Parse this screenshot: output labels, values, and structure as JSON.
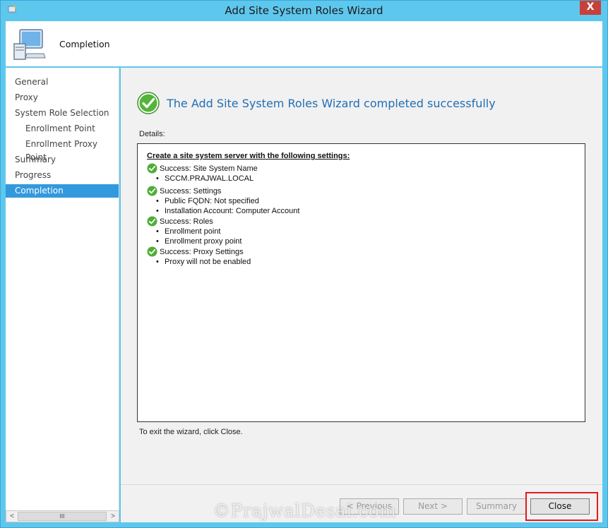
{
  "window": {
    "title": "Add Site System Roles Wizard",
    "close_glyph": "X"
  },
  "header": {
    "title": "Completion",
    "icon": "computer-icon"
  },
  "nav": {
    "items": [
      {
        "label": "General",
        "sub": false,
        "active": false
      },
      {
        "label": "Proxy",
        "sub": false,
        "active": false
      },
      {
        "label": "System Role Selection",
        "sub": false,
        "active": false
      },
      {
        "label": "Enrollment Point",
        "sub": true,
        "active": false
      },
      {
        "label": "Enrollment Proxy Point",
        "sub": true,
        "active": false
      },
      {
        "label": "Summary",
        "sub": false,
        "active": false
      },
      {
        "label": "Progress",
        "sub": false,
        "active": false
      },
      {
        "label": "Completion",
        "sub": false,
        "active": true
      }
    ],
    "scrollbar": {
      "left_arrow": "<",
      "right_arrow": ">",
      "thumb_grip": "III"
    }
  },
  "content": {
    "success_message": "The Add Site System Roles Wizard completed successfully",
    "details_label": "Details:",
    "details": {
      "heading": "Create a site system server with the following settings:",
      "groups": [
        {
          "status": "Success: Site System Name",
          "items": [
            "SCCM.PRAJWAL.LOCAL"
          ]
        },
        {
          "status": "Success: Settings",
          "items": [
            "Public FQDN: Not specified",
            "Installation Account: Computer Account"
          ]
        },
        {
          "status": "Success: Roles",
          "items": [
            "Enrollment point",
            "Enrollment proxy point"
          ]
        },
        {
          "status": "Success: Proxy Settings",
          "items": [
            "Proxy will not be enabled"
          ]
        }
      ]
    },
    "exit_hint": "To exit the wizard, click Close."
  },
  "footer": {
    "previous_label": "< Previous",
    "next_label": "Next >",
    "summary_label": "Summary",
    "close_label": "Close"
  },
  "watermark": "©PrajwalDesai.com",
  "colors": {
    "title_bar": "#5ec7ee",
    "accent": "#3399dd",
    "success_text": "#1f6fb5",
    "highlight": "#e01c1c"
  }
}
